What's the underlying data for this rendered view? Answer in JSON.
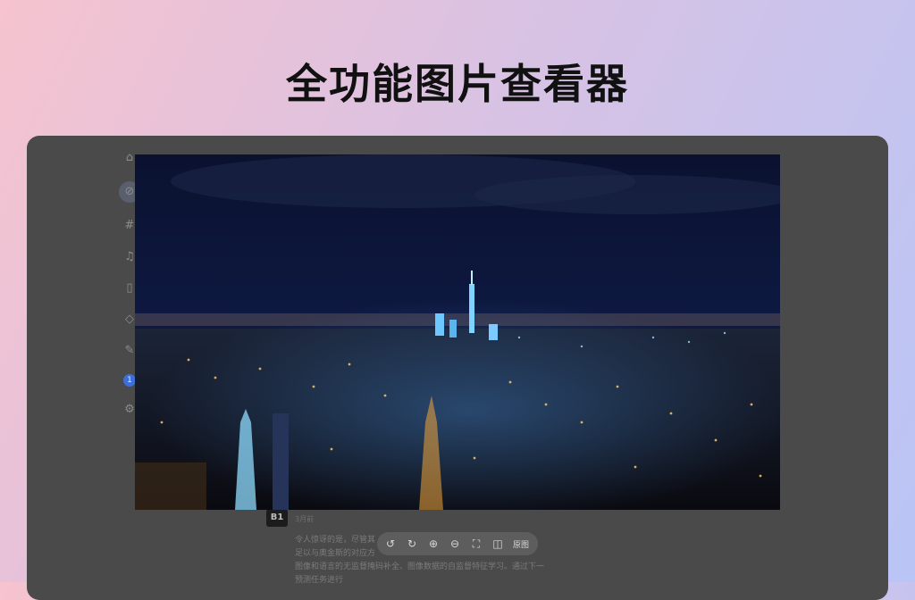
{
  "headline": "全功能图片查看器",
  "sidebar": {
    "items": [
      {
        "icon": "home-icon",
        "glyph": "⌂"
      },
      {
        "icon": "compass-icon",
        "glyph": "⊘",
        "active": true
      },
      {
        "icon": "hashtag-icon",
        "glyph": "#"
      },
      {
        "icon": "bell-icon",
        "glyph": "♫"
      },
      {
        "icon": "bookmark-icon",
        "glyph": "▯"
      },
      {
        "icon": "shield-icon",
        "glyph": "◇"
      },
      {
        "icon": "pen-icon",
        "glyph": "✎"
      },
      {
        "icon": "notification-badge",
        "glyph": "1"
      },
      {
        "icon": "settings-icon",
        "glyph": "⚙"
      }
    ]
  },
  "post": {
    "avatar_text": "B1",
    "time": "3月前",
    "lines": [
      "令人惊讶的是，尽管其",
      "足以与奥金斯的对应方",
      "图像和语言的无监督掩码补全、图像数据的自监督特征学习。通过下一",
      "预测任务进行"
    ]
  },
  "toolbar": {
    "rotate_left": "↺",
    "rotate_right": "↻",
    "zoom_in": "⊕",
    "zoom_out": "⊖",
    "fit": "⛶",
    "flip": "◫",
    "original_label": "原图"
  },
  "colors": {
    "frame": "#4a4a4a",
    "toolbar": "#5d5d5d",
    "accent_badge": "#3d6fd8"
  }
}
